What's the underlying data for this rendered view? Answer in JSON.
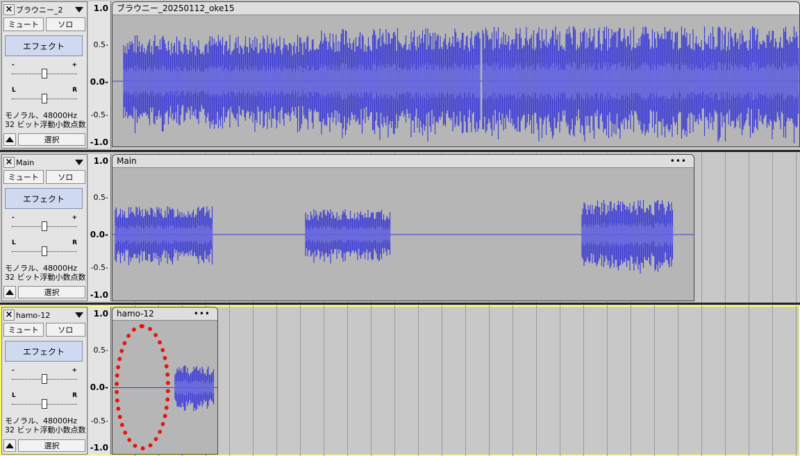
{
  "tracks": [
    {
      "name": "ブラウニー_2",
      "clip_name": "ブラウニー_20250112_oke15",
      "mute_label": "ミュート",
      "solo_label": "ソロ",
      "effect_label": "エフェクト",
      "gain_minus": "-",
      "gain_plus": "+",
      "pan_left": "L",
      "pan_right": "R",
      "format_line1": "モノラル、48000Hz",
      "format_line2": "32 ビット浮動小数点数",
      "select_label": "選択",
      "selected": false
    },
    {
      "name": "Main",
      "clip_name": "Main",
      "clip_menu": "•••",
      "mute_label": "ミュート",
      "solo_label": "ソロ",
      "effect_label": "エフェクト",
      "gain_minus": "-",
      "gain_plus": "+",
      "pan_left": "L",
      "pan_right": "R",
      "format_line1": "モノラル、48000Hz",
      "format_line2": "32 ビット浮動小数点数",
      "select_label": "選択",
      "selected": false
    },
    {
      "name": "hamo-12",
      "clip_name": "hamo-12",
      "clip_menu": "•••",
      "mute_label": "ミュート",
      "solo_label": "ソロ",
      "effect_label": "エフェクト",
      "gain_minus": "-",
      "gain_plus": "+",
      "pan_left": "L",
      "pan_right": "R",
      "format_line1": "モノラル、48000Hz",
      "format_line2": "32 ビット浮動小数点数",
      "select_label": "選択",
      "selected": true
    }
  ],
  "ruler_ticks": [
    "1.0",
    "0.5-",
    "0.0-",
    "-0.5-",
    "-1.0"
  ],
  "colors": {
    "waveform": "#3a3ad6",
    "waveform_rms": "#6464e0",
    "clip_bg": "#b6b6b6",
    "selected_outline": "#ffff66",
    "annotation": "#e8140c"
  }
}
